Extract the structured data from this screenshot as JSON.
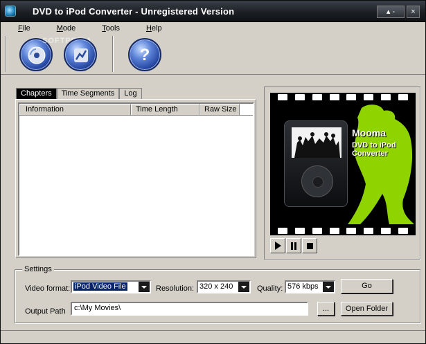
{
  "window": {
    "title": "DVD to iPod Converter - Unregistered Version",
    "btn_restore": "▴ -",
    "btn_close": "×"
  },
  "menu": [
    {
      "label": "File",
      "u": "F",
      "rest": "ile"
    },
    {
      "label": "Mode",
      "u": "M",
      "rest": "ode"
    },
    {
      "label": "Tools",
      "u": "T",
      "rest": "ools"
    },
    {
      "label": "Help",
      "u": "H",
      "rest": "elp"
    }
  ],
  "toolbar": {
    "watermark": "SOFTPEDIA",
    "help_glyph": "?"
  },
  "tabs": [
    {
      "label": "Chapters"
    },
    {
      "label": "Time Segments"
    },
    {
      "label": "Log"
    }
  ],
  "list": {
    "columns": [
      "Information",
      "Time Length",
      "Raw Size"
    ]
  },
  "preview": {
    "brand1": "Mooma",
    "brand2": "DVD to iPod",
    "brand3": "Converter"
  },
  "settings": {
    "legend": "Settings",
    "video_format_label": "Video format:",
    "video_format_value": "iPod Video File",
    "resolution_label": "Resolution:",
    "resolution_value": "320 x 240",
    "quality_label": "Quality:",
    "quality_value": "576 kbps",
    "go_label": "Go",
    "output_path_label": "Output Path",
    "output_path_value": "c:\\My Movies\\",
    "browse_label": "...",
    "open_folder_label": "Open Folder"
  },
  "colors": {
    "selection": "#0a246a",
    "lime": "#8fd400"
  }
}
